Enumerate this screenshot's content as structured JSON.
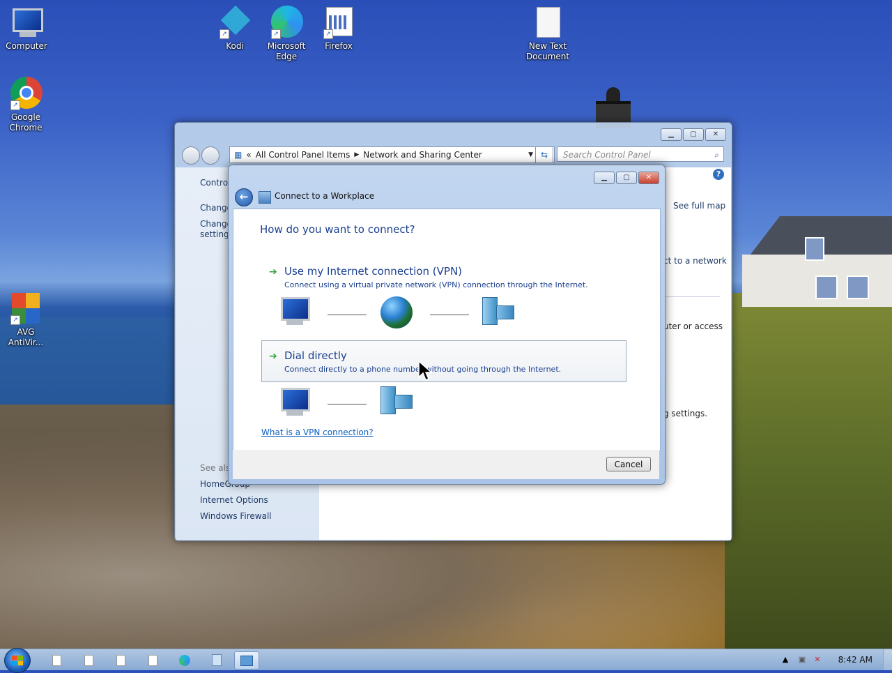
{
  "desktop": {
    "icons": [
      {
        "label": "Computer"
      },
      {
        "label": "Kodi"
      },
      {
        "label": "Microsoft Edge"
      },
      {
        "label": "Firefox"
      },
      {
        "label": "New Text Document"
      },
      {
        "label": "Google Chrome"
      },
      {
        "label": "AVG AntiVir..."
      }
    ]
  },
  "control_panel": {
    "breadcrumb_root": "All Control Panel Items",
    "breadcrumb_current": "Network and Sharing Center",
    "breadcrumb_prefix": "«",
    "search_placeholder": "Search Control Panel",
    "left": {
      "link1": "Control",
      "link2": "Change",
      "link3a": "Change",
      "link3b": "settings",
      "see_also": "See also",
      "homegroup": "HomeGroup",
      "internet_options": "Internet Options",
      "windows_firewall": "Windows Firewall"
    },
    "right": {
      "see_full_map": "See full map",
      "connect_network": "ct to a network",
      "computer_access": "uter or access",
      "settings": "g settings."
    }
  },
  "dialog": {
    "title": "Connect to a Workplace",
    "heading": "How do you want to connect?",
    "options": [
      {
        "title": "Use my Internet connection (VPN)",
        "desc": "Connect using a virtual private network (VPN) connection through the Internet."
      },
      {
        "title": "Dial directly",
        "desc": "Connect directly to a phone number without going through the Internet."
      }
    ],
    "link": "What is a VPN connection?",
    "cancel": "Cancel"
  },
  "taskbar": {
    "clock": "8:42 AM"
  }
}
